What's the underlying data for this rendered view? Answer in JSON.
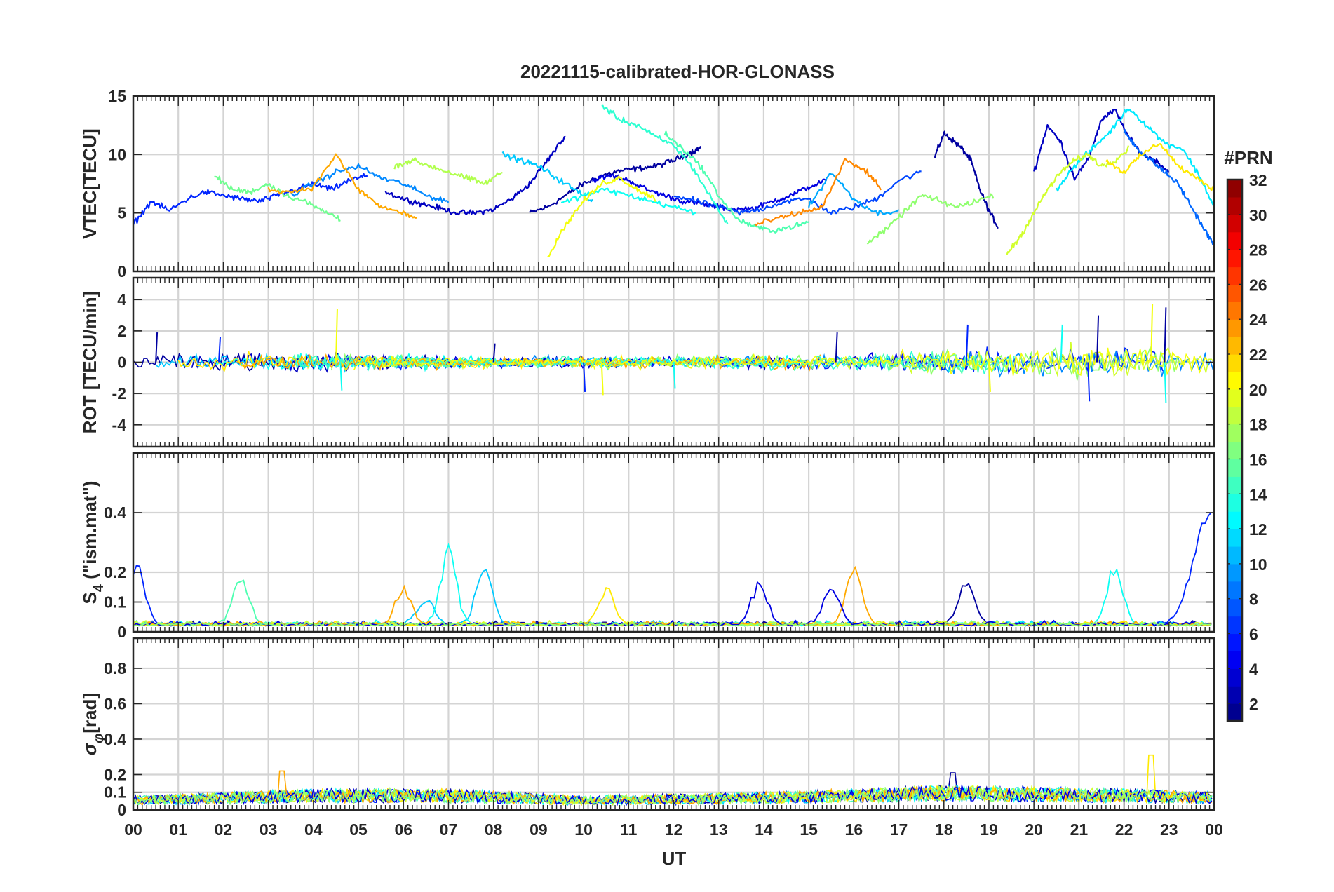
{
  "figure": {
    "title": "20221115-calibrated-HOR-GLONASS"
  },
  "chart_data": [
    {
      "type": "line",
      "panel": "vtec",
      "ylabel": "VTEC[TECU]",
      "ylim": [
        0,
        15
      ],
      "yticks": [
        0,
        5,
        10,
        15
      ],
      "ytick_labels": [
        "0",
        "5",
        "10",
        "15"
      ],
      "xlim": [
        0,
        24
      ],
      "grid": true,
      "series_note": "",
      "series": [
        {
          "prn": 2,
          "x": [
            8.8,
            9.2,
            9.6,
            10.0,
            10.4,
            10.8,
            11.2,
            11.6,
            12.0,
            12.4,
            12.6
          ],
          "y": [
            5.0,
            5.5,
            6.5,
            7.5,
            8.2,
            8.6,
            8.8,
            9.0,
            9.5,
            10.2,
            10.6
          ]
        },
        {
          "prn": 2,
          "x": [
            17.8,
            18.0,
            18.2,
            18.4,
            18.6,
            18.8,
            19.0,
            19.2
          ],
          "y": [
            9.8,
            11.8,
            11.2,
            10.5,
            9.5,
            7.0,
            5.2,
            3.8
          ]
        },
        {
          "prn": 3,
          "x": [
            5.6,
            6.0,
            6.4,
            6.8,
            7.2,
            7.6,
            8.0,
            8.4,
            8.8,
            9.2,
            9.6
          ],
          "y": [
            6.8,
            6.2,
            5.8,
            5.4,
            5.0,
            5.0,
            5.3,
            6.2,
            7.5,
            9.5,
            11.6
          ]
        },
        {
          "prn": 3,
          "x": [
            20.0,
            20.3,
            20.6,
            20.9,
            21.2,
            21.5,
            21.8,
            22.1,
            22.4,
            22.7,
            23.0
          ],
          "y": [
            8.5,
            12.5,
            11.0,
            8.0,
            9.5,
            13.0,
            13.8,
            11.5,
            10.0,
            9.5,
            8.5
          ]
        },
        {
          "prn": 4,
          "x": [
            10.2,
            10.6,
            11.0,
            11.4,
            11.8,
            12.2,
            12.6,
            13.0,
            13.4,
            13.8,
            14.2,
            14.6,
            15.0,
            15.4
          ],
          "y": [
            7.8,
            8.2,
            7.8,
            7.0,
            6.5,
            6.0,
            5.8,
            5.5,
            5.3,
            5.4,
            6.0,
            6.5,
            7.2,
            7.8
          ]
        },
        {
          "prn": 6,
          "x": [
            0.0,
            0.4,
            0.8,
            1.2,
            1.6,
            2.0,
            2.4,
            2.8,
            3.2,
            3.6,
            4.0,
            4.4,
            4.8,
            5.2
          ],
          "y": [
            4.0,
            6.0,
            5.2,
            6.2,
            6.8,
            6.5,
            6.2,
            6.0,
            6.5,
            7.0,
            7.5,
            7.0,
            7.8,
            8.2
          ]
        },
        {
          "prn": 7,
          "x": [
            12.0,
            12.5,
            13.0,
            13.5,
            14.0,
            14.5,
            15.0,
            15.5,
            16.0,
            16.5,
            17.0,
            17.5
          ],
          "y": [
            6.5,
            6.0,
            5.5,
            5.0,
            5.4,
            6.0,
            6.2,
            5.0,
            5.5,
            6.2,
            7.8,
            8.5
          ]
        },
        {
          "prn": 8,
          "x": [
            22.0,
            22.3,
            22.6,
            22.9,
            23.2,
            23.5,
            23.8,
            24.0
          ],
          "y": [
            12.0,
            10.5,
            9.5,
            8.5,
            7.5,
            5.5,
            3.5,
            2.2
          ]
        },
        {
          "prn": 9,
          "x": [
            3.5,
            4.0,
            4.5,
            5.0,
            5.5,
            6.0,
            6.5,
            7.0
          ],
          "y": [
            6.5,
            7.5,
            8.5,
            9.0,
            8.0,
            7.5,
            6.5,
            6.0
          ]
        },
        {
          "prn": 10,
          "x": [
            15.0,
            15.5,
            16.0,
            16.5,
            17.0
          ],
          "y": [
            5.5,
            8.5,
            6.2,
            5.0,
            5.2
          ]
        },
        {
          "prn": 11,
          "x": [
            8.2,
            8.6,
            9.0,
            9.4,
            9.8,
            10.2
          ],
          "y": [
            10.0,
            9.5,
            9.0,
            8.0,
            7.0,
            6.0
          ]
        },
        {
          "prn": 12,
          "x": [
            20.5,
            20.9,
            21.3,
            21.7,
            22.1,
            22.5,
            22.9,
            23.3,
            23.7,
            24.0
          ],
          "y": [
            7.0,
            9.0,
            10.5,
            12.0,
            14.0,
            12.5,
            11.0,
            10.5,
            8.0,
            5.5
          ]
        },
        {
          "prn": 13,
          "x": [
            9.5,
            10.0,
            10.5,
            11.0,
            11.5,
            12.0,
            12.5
          ],
          "y": [
            5.8,
            6.5,
            7.0,
            6.5,
            6.0,
            5.5,
            5.0
          ]
        },
        {
          "prn": 14,
          "x": [
            10.4,
            10.8,
            11.2,
            11.6,
            12.0,
            12.4,
            12.8,
            13.2
          ],
          "y": [
            14.2,
            13.0,
            12.5,
            11.5,
            10.8,
            9.0,
            6.5,
            4.0
          ]
        },
        {
          "prn": 15,
          "x": [
            11.8,
            12.2,
            12.6,
            13.0,
            13.4,
            13.8,
            14.2,
            14.6,
            15.0
          ],
          "y": [
            11.8,
            10.5,
            9.0,
            6.5,
            4.5,
            3.8,
            3.5,
            3.8,
            4.2
          ]
        },
        {
          "prn": 16,
          "x": [
            1.8,
            2.2,
            2.6,
            3.0,
            3.4,
            3.8,
            4.2,
            4.6
          ],
          "y": [
            8.2,
            7.0,
            6.8,
            7.5,
            6.5,
            6.0,
            5.2,
            4.5
          ]
        },
        {
          "prn": 17,
          "x": [
            16.3,
            16.7,
            17.1,
            17.5,
            17.9,
            18.3,
            18.7,
            19.1
          ],
          "y": [
            2.5,
            3.5,
            5.0,
            6.5,
            6.0,
            5.5,
            6.0,
            6.5
          ]
        },
        {
          "prn": 18,
          "x": [
            5.8,
            6.2,
            6.6,
            7.0,
            7.4,
            7.8,
            8.2
          ],
          "y": [
            9.0,
            9.5,
            9.0,
            8.5,
            8.0,
            7.5,
            8.5
          ]
        },
        {
          "prn": 19,
          "x": [
            19.4,
            19.7,
            20.0,
            20.3,
            20.6,
            20.9,
            21.2,
            21.5,
            21.8,
            22.1
          ],
          "y": [
            1.5,
            3.0,
            5.0,
            7.0,
            8.5,
            9.5,
            10.0,
            9.0,
            9.5,
            10.5
          ]
        },
        {
          "prn": 20,
          "x": [
            9.2,
            9.6,
            10.0,
            10.4,
            10.8,
            11.2,
            11.6
          ],
          "y": [
            1.2,
            4.0,
            6.0,
            7.5,
            8.0,
            7.0,
            6.2
          ]
        },
        {
          "prn": 21,
          "x": [
            21.6,
            22.0,
            22.4,
            22.8,
            23.2,
            23.6,
            24.0
          ],
          "y": [
            9.5,
            8.5,
            10.0,
            11.0,
            9.0,
            8.0,
            7.0
          ]
        },
        {
          "prn": 23,
          "x": [
            3.0,
            3.5,
            4.0,
            4.5,
            5.0,
            5.5,
            6.0,
            6.3
          ],
          "y": [
            7.0,
            6.8,
            7.2,
            10.0,
            7.0,
            5.5,
            5.0,
            4.5
          ]
        },
        {
          "prn": 24,
          "x": [
            13.8,
            14.3,
            14.8,
            15.3,
            15.8,
            16.3,
            16.6
          ],
          "y": [
            4.0,
            4.5,
            5.0,
            5.5,
            9.5,
            8.5,
            7.0
          ]
        }
      ]
    },
    {
      "type": "line",
      "panel": "rot",
      "ylabel": "ROT [TECU/min]",
      "ylim": [
        -5.4,
        5.4
      ],
      "yticks": [
        -4,
        -2,
        0,
        2,
        4
      ],
      "ytick_labels": [
        "-4",
        "-2",
        "0",
        "2",
        "4"
      ],
      "xlim": [
        0,
        24
      ],
      "grid": true,
      "spikes": [
        {
          "x": 0.5,
          "y": 1.9
        },
        {
          "x": 1.9,
          "y": 1.6
        },
        {
          "x": 4.5,
          "y": 3.4
        },
        {
          "x": 4.6,
          "y": -1.8
        },
        {
          "x": 8.0,
          "y": 1.2
        },
        {
          "x": 10.0,
          "y": -1.9
        },
        {
          "x": 10.4,
          "y": -2.1
        },
        {
          "x": 12.0,
          "y": -1.7
        },
        {
          "x": 15.6,
          "y": 1.9
        },
        {
          "x": 18.5,
          "y": 2.4
        },
        {
          "x": 19.0,
          "y": -1.9
        },
        {
          "x": 20.6,
          "y": 2.4
        },
        {
          "x": 21.4,
          "y": 3.0
        },
        {
          "x": 21.2,
          "y": -2.5
        },
        {
          "x": 22.6,
          "y": 3.7
        },
        {
          "x": 22.9,
          "y": -2.6
        },
        {
          "x": 22.9,
          "y": 3.5
        }
      ],
      "noise_envelope": [
        {
          "x": 0,
          "amp": 0.5
        },
        {
          "x": 4,
          "amp": 0.6
        },
        {
          "x": 8,
          "amp": 0.35
        },
        {
          "x": 12,
          "amp": 0.4
        },
        {
          "x": 16,
          "amp": 0.5
        },
        {
          "x": 18,
          "amp": 0.8
        },
        {
          "x": 20,
          "amp": 1.0
        },
        {
          "x": 22,
          "amp": 1.1
        },
        {
          "x": 24,
          "amp": 0.7
        }
      ]
    },
    {
      "type": "line",
      "panel": "s4",
      "ylabel": "S",
      "ylabel_sub": "4",
      "ylabel_rest": " (\"ism.mat\")",
      "ylim": [
        0,
        0.6
      ],
      "yticks": [
        0,
        0.1,
        0.2,
        0.4
      ],
      "ytick_labels": [
        "0",
        "0.1",
        "0.2",
        "0.4"
      ],
      "xlim": [
        0,
        24
      ],
      "grid": true,
      "peaks": [
        {
          "x": 0.1,
          "y": 0.2,
          "prn": 6
        },
        {
          "x": 0.6,
          "y": 0.1,
          "prn": 14
        },
        {
          "x": 2.4,
          "y": 0.17,
          "prn": 15
        },
        {
          "x": 4.8,
          "y": 0.1,
          "prn": 22
        },
        {
          "x": 6.0,
          "y": 0.13,
          "prn": 23
        },
        {
          "x": 6.5,
          "y": 0.1,
          "prn": 11
        },
        {
          "x": 7.0,
          "y": 0.26,
          "prn": 13
        },
        {
          "x": 7.8,
          "y": 0.22,
          "prn": 11
        },
        {
          "x": 10.5,
          "y": 0.13,
          "prn": 21
        },
        {
          "x": 13.9,
          "y": 0.15,
          "prn": 4
        },
        {
          "x": 15.5,
          "y": 0.14,
          "prn": 4
        },
        {
          "x": 16.0,
          "y": 0.22,
          "prn": 23
        },
        {
          "x": 18.5,
          "y": 0.16,
          "prn": 2
        },
        {
          "x": 21.8,
          "y": 0.21,
          "prn": 13
        },
        {
          "x": 23.9,
          "y": 0.42,
          "prn": 6
        }
      ]
    },
    {
      "type": "line",
      "panel": "sigma_phi",
      "ylabel": "σ",
      "ylabel_sub": "φ",
      "ylabel_rest": "[rad]",
      "ylim": [
        0,
        0.97
      ],
      "yticks": [
        0,
        0.1,
        0.2,
        0.4,
        0.6,
        0.8
      ],
      "ytick_labels": [
        "0",
        "0.1",
        "0.2",
        "0.4",
        "0.6",
        "0.8"
      ],
      "xlim": [
        0,
        24
      ],
      "grid": true,
      "band_levels": [
        {
          "x": 0,
          "y": 0.08
        },
        {
          "x": 4,
          "y": 0.12
        },
        {
          "x": 7,
          "y": 0.12
        },
        {
          "x": 10,
          "y": 0.08
        },
        {
          "x": 14,
          "y": 0.1
        },
        {
          "x": 18,
          "y": 0.14
        },
        {
          "x": 22,
          "y": 0.12
        },
        {
          "x": 24,
          "y": 0.1
        }
      ],
      "peaks": [
        {
          "x": 22.6,
          "y": 0.31,
          "prn": 21
        },
        {
          "x": 18.2,
          "y": 0.21,
          "prn": 2
        },
        {
          "x": 3.3,
          "y": 0.22,
          "prn": 23
        }
      ]
    }
  ],
  "x_axis": {
    "label": "UT",
    "ticks": [
      0,
      1,
      2,
      3,
      4,
      5,
      6,
      7,
      8,
      9,
      10,
      11,
      12,
      13,
      14,
      15,
      16,
      17,
      18,
      19,
      20,
      21,
      22,
      23,
      24
    ],
    "tick_labels": [
      "00",
      "01",
      "02",
      "03",
      "04",
      "05",
      "06",
      "07",
      "08",
      "09",
      "10",
      "11",
      "12",
      "13",
      "14",
      "15",
      "16",
      "17",
      "18",
      "19",
      "20",
      "21",
      "22",
      "23",
      "00"
    ]
  },
  "colorbar": {
    "title": "#PRN",
    "range": [
      1,
      32
    ],
    "ticks": [
      2,
      4,
      6,
      8,
      10,
      12,
      14,
      16,
      18,
      20,
      22,
      24,
      26,
      28,
      30,
      32
    ],
    "tick_labels": [
      "2",
      "4",
      "6",
      "8",
      "10",
      "12",
      "14",
      "16",
      "18",
      "20",
      "22",
      "24",
      "26",
      "28",
      "30",
      "32"
    ],
    "colormap": "jet"
  }
}
